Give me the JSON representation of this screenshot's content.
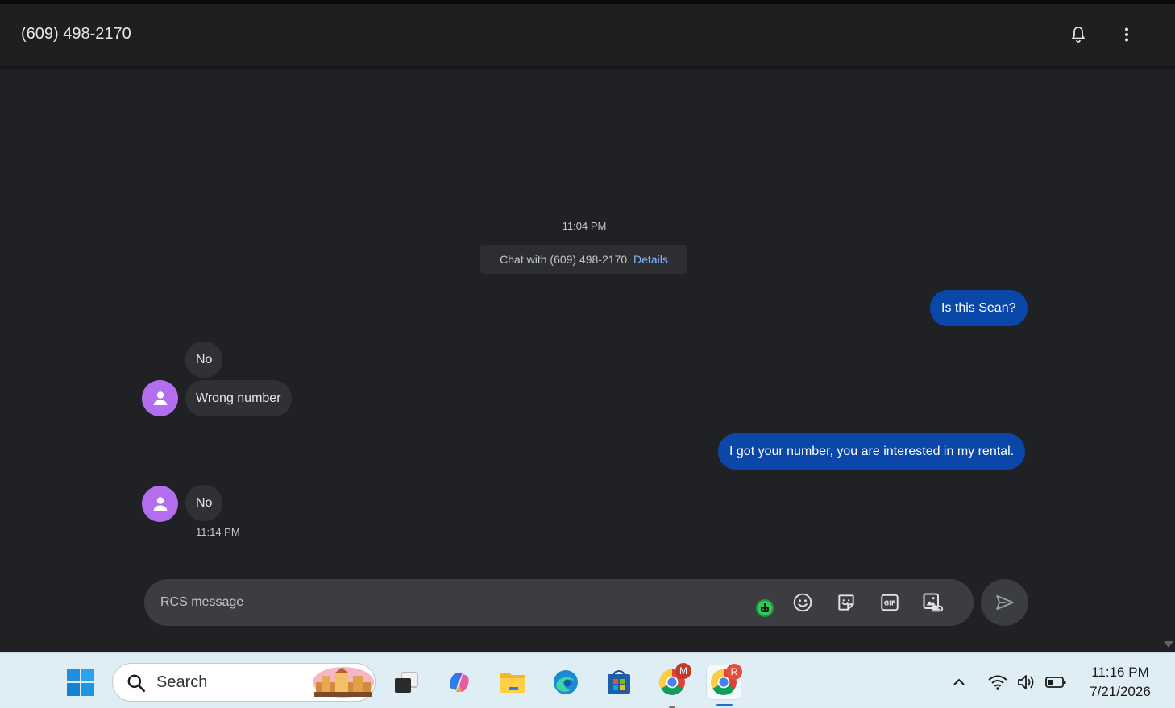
{
  "header": {
    "title": "(609) 498-2170",
    "notifications_icon": "bell-icon",
    "menu_icon": "more-vert-icon"
  },
  "chat": {
    "start_time": "11:04 PM",
    "info_text": "Chat with (609) 498-2170.",
    "info_link": "Details",
    "messages": [
      {
        "direction": "out",
        "text": "Is this Sean?"
      },
      {
        "direction": "in",
        "text": "No"
      },
      {
        "direction": "in",
        "text": "Wrong number"
      },
      {
        "direction": "out",
        "text": "I got your number, you are interested in my rental."
      },
      {
        "direction": "in",
        "text": "No",
        "time": "11:14 PM"
      }
    ]
  },
  "composer": {
    "placeholder": "RCS message",
    "icons": [
      "bot-icon",
      "emoji-icon",
      "sticker-icon",
      "gif-icon",
      "attach-media-icon"
    ],
    "send_icon": "send-icon"
  },
  "taskbar": {
    "search_label": "Search",
    "apps": [
      "windows-start-icon",
      "task-view-icon",
      "copilot-icon",
      "file-explorer-icon",
      "edge-icon",
      "store-icon",
      "chrome-icon",
      "chrome-icon"
    ],
    "chrome1_badge": "M",
    "chrome2_badge": "R",
    "time": "11:16 PM",
    "date": "7/21/2026"
  },
  "colors": {
    "background": "#202124",
    "outgoing_bubble": "#0b47a8",
    "incoming_bubble": "#303134",
    "avatar": "#b36ef0",
    "link": "#8ab4f8"
  }
}
